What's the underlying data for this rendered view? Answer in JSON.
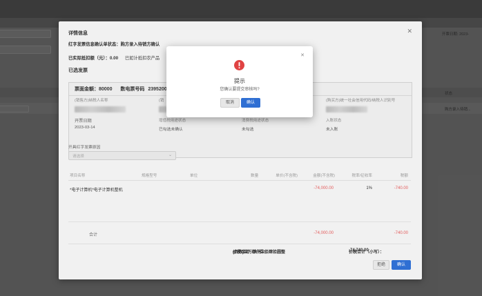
{
  "background": {
    "label_right": "开票日期:",
    "date_right": "2023-",
    "col_status": "状态",
    "row_status": "购方录入待销..."
  },
  "modal": {
    "title": "详情信息",
    "close_icon": "close-icon",
    "status_label": "红字发票信息确认单状态：",
    "status_value": "购方录入待销方确认",
    "deducted_label": "已实际抵扣额（元）：",
    "deducted_value": "0.00",
    "agri_label": "已如计抵扣农产品",
    "selected_title": "已选发票",
    "invoice": {
      "amount_label": "票面金额：",
      "amount_value": "80000",
      "number_label": "数电票号码",
      "number_value": "2395200",
      "seller_label": "(销售方)纳税人名称",
      "col2_label": "(销",
      "buyer_label": "(购买方)统一社会信用代码/纳税人识别号",
      "date_label": "开票日期",
      "date_value": "2023-03-14",
      "status1_label": "增值税用途状态",
      "status1_value": "已勾选未确认",
      "status2_label": "消费税用途状态",
      "status2_value": "未勾选",
      "status3_label": "入账状态",
      "status3_value": "未入账"
    },
    "reason_label": "开具红字发票原因",
    "reason_placeholder": "请选择",
    "table": {
      "headers": [
        "项目名称",
        "规格型号",
        "单位",
        "数量",
        "单价(不含税)",
        "金额(不含税)",
        "税率/征收率",
        "税额"
      ],
      "row": {
        "name": "*电子计算机*电子计算机整机",
        "amount": "-74,000.00",
        "rate": "1%",
        "tax": "-740.00"
      },
      "total_label": "合计",
      "total_amount": "-74,000.00",
      "total_tax": "-740.00",
      "sum_upper_label": "价税合计（大写）：",
      "sum_upper_value": "(负数)柒万肆仟柒佰肆拾圆整",
      "sum_lower_label": "价税合计（小写）：",
      "sum_lower_value": "-74,740.00"
    },
    "buttons": {
      "reject": "拒绝",
      "confirm": "确认"
    }
  },
  "confirm_dialog": {
    "icon": "warning-icon",
    "title": "提示",
    "message": "您确认要提交审核吗?",
    "cancel": "取消",
    "ok": "确认"
  },
  "colors": {
    "primary": "#2f6fd3",
    "danger": "#e04343",
    "negative_text": "#e35c5c"
  }
}
